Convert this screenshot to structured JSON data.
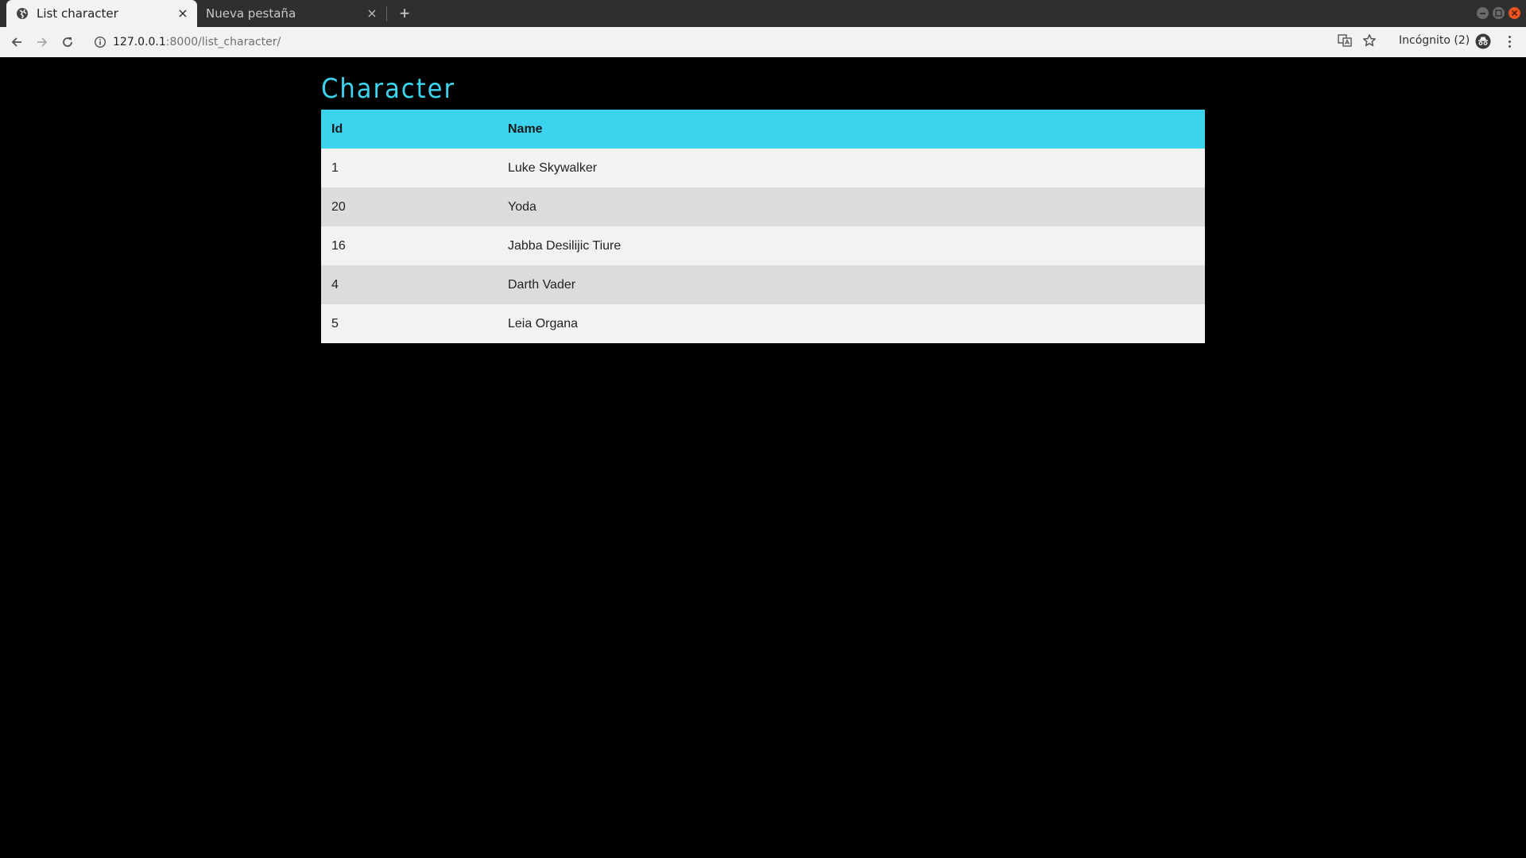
{
  "browser": {
    "tabs": [
      {
        "label": "List character",
        "active": true
      },
      {
        "label": "Nueva pestaña",
        "active": false
      }
    ],
    "url_host": "127.0.0.1",
    "url_path": ":8000/list_character/",
    "incognito_label": "Incógnito (2)"
  },
  "page": {
    "title": "Character",
    "table": {
      "headers": [
        "Id",
        "Name"
      ],
      "rows": [
        {
          "id": "1",
          "name": "Luke Skywalker"
        },
        {
          "id": "20",
          "name": "Yoda"
        },
        {
          "id": "16",
          "name": "Jabba Desilijic Tiure"
        },
        {
          "id": "4",
          "name": "Darth Vader"
        },
        {
          "id": "5",
          "name": "Leia Organa"
        }
      ]
    }
  },
  "colors": {
    "accent": "#3bd3ee",
    "page_background": "#000000",
    "row_light": "#f2f2f2",
    "row_dark": "#dcdcdc"
  }
}
